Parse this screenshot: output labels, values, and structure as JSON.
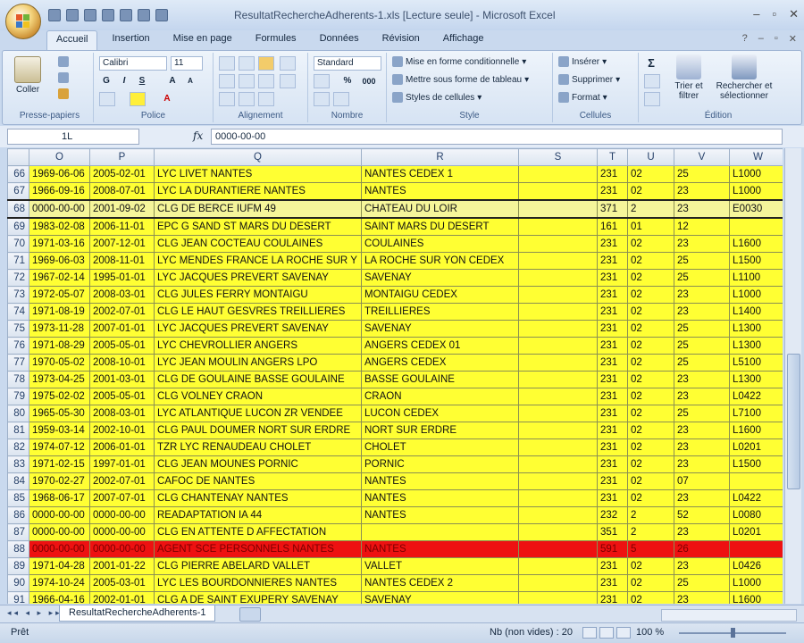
{
  "window": {
    "title": "ResultatRechercheAdherents-1.xls  [Lecture seule] - Microsoft Excel",
    "controls": [
      "–",
      "▫",
      "✕"
    ]
  },
  "ribbon_tabs": [
    "Accueil",
    "Insertion",
    "Mise en page",
    "Formules",
    "Données",
    "Révision",
    "Affichage"
  ],
  "ribbon": {
    "clipboard": {
      "label": "Presse-papiers",
      "paste": "Coller"
    },
    "font": {
      "label": "Police",
      "name": "Calibri",
      "size": "11",
      "bold": "G",
      "italic": "I",
      "underline": "S"
    },
    "alignment": {
      "label": "Alignement"
    },
    "number": {
      "label": "Nombre",
      "format": "Standard",
      "percent": "%",
      "thousands": "000"
    },
    "style": {
      "label": "Style",
      "conditional": "Mise en forme conditionnelle",
      "table": "Mettre sous forme de tableau",
      "cell_styles": "Styles de cellules"
    },
    "cells": {
      "label": "Cellules",
      "insert": "Insérer",
      "delete": "Supprimer",
      "format": "Format"
    },
    "editing": {
      "label": "Édition",
      "sort": "Trier et filtrer",
      "find": "Rechercher et sélectionner",
      "sigma": "Σ"
    }
  },
  "formula_bar": {
    "name_box": "1L",
    "fx": "fx",
    "content": "0000-00-00"
  },
  "columns": [
    "O",
    "P",
    "Q",
    "R",
    "S",
    "T",
    "U",
    "V",
    "W"
  ],
  "rows": [
    {
      "n": "66",
      "cells": [
        "1969-06-06",
        "2005-02-01",
        "LYC LIVET NANTES",
        "NANTES CEDEX 1",
        "",
        "231",
        "02",
        "25",
        "L1000"
      ]
    },
    {
      "n": "67",
      "cells": [
        "1966-09-16",
        "2008-07-01",
        "LYC LA DURANTIERE NANTES",
        "NANTES",
        "",
        "231",
        "02",
        "23",
        "L1000"
      ]
    },
    {
      "n": "68",
      "cells": [
        "0000-00-00",
        "2001-09-02",
        "CLG DE BERCE IUFM 49",
        "CHATEAU DU LOIR",
        "",
        "371",
        "2",
        "23",
        "E0030"
      ],
      "selected": true
    },
    {
      "n": "69",
      "cells": [
        "1983-02-08",
        "2006-11-01",
        "EPC G SAND ST MARS DU DESERT",
        "SAINT MARS DU DESERT",
        "",
        "161",
        "01",
        "12",
        ""
      ]
    },
    {
      "n": "70",
      "cells": [
        "1971-03-16",
        "2007-12-01",
        "CLG JEAN COCTEAU COULAINES",
        "COULAINES",
        "",
        "231",
        "02",
        "23",
        "L1600"
      ]
    },
    {
      "n": "71",
      "cells": [
        "1969-06-03",
        "2008-11-01",
        "LYC MENDES FRANCE LA ROCHE SUR Y",
        "LA ROCHE SUR YON CEDEX",
        "",
        "231",
        "02",
        "25",
        "L1500"
      ]
    },
    {
      "n": "72",
      "cells": [
        "1967-02-14",
        "1995-01-01",
        "LYC JACQUES PREVERT SAVENAY",
        "SAVENAY",
        "",
        "231",
        "02",
        "25",
        "L1100"
      ]
    },
    {
      "n": "73",
      "cells": [
        "1972-05-07",
        "2008-03-01",
        "CLG JULES FERRY MONTAIGU",
        "MONTAIGU CEDEX",
        "",
        "231",
        "02",
        "23",
        "L1000"
      ]
    },
    {
      "n": "74",
      "cells": [
        "1971-08-19",
        "2002-07-01",
        "CLG LE HAUT GESVRES TREILLIERES",
        "TREILLIERES",
        "",
        "231",
        "02",
        "23",
        "L1400"
      ]
    },
    {
      "n": "75",
      "cells": [
        "1973-11-28",
        "2007-01-01",
        "LYC JACQUES PREVERT SAVENAY",
        "SAVENAY",
        "",
        "231",
        "02",
        "25",
        "L1300"
      ]
    },
    {
      "n": "76",
      "cells": [
        "1971-08-29",
        "2005-05-01",
        "LYC CHEVROLLIER ANGERS",
        "ANGERS CEDEX 01",
        "",
        "231",
        "02",
        "25",
        "L1300"
      ]
    },
    {
      "n": "77",
      "cells": [
        "1970-05-02",
        "2008-10-01",
        "LYC JEAN MOULIN ANGERS LPO",
        "ANGERS CEDEX",
        "",
        "231",
        "02",
        "25",
        "L5100"
      ]
    },
    {
      "n": "78",
      "cells": [
        "1973-04-25",
        "2001-03-01",
        "CLG DE GOULAINE BASSE GOULAINE",
        "BASSE GOULAINE",
        "",
        "231",
        "02",
        "23",
        "L1300"
      ]
    },
    {
      "n": "79",
      "cells": [
        "1975-02-02",
        "2005-05-01",
        "CLG VOLNEY CRAON",
        "CRAON",
        "",
        "231",
        "02",
        "23",
        "L0422"
      ]
    },
    {
      "n": "80",
      "cells": [
        "1965-05-30",
        "2008-03-01",
        "LYC ATLANTIQUE LUCON ZR VENDEE",
        "LUCON CEDEX",
        "",
        "231",
        "02",
        "25",
        "L7100"
      ]
    },
    {
      "n": "81",
      "cells": [
        "1959-03-14",
        "2002-10-01",
        "CLG PAUL DOUMER NORT SUR ERDRE",
        "NORT SUR ERDRE",
        "",
        "231",
        "02",
        "23",
        "L1600"
      ]
    },
    {
      "n": "82",
      "cells": [
        "1974-07-12",
        "2006-01-01",
        "TZR LYC RENAUDEAU CHOLET",
        "CHOLET",
        "",
        "231",
        "02",
        "23",
        "L0201"
      ]
    },
    {
      "n": "83",
      "cells": [
        "1971-02-15",
        "1997-01-01",
        "CLG JEAN MOUNES PORNIC",
        "PORNIC",
        "",
        "231",
        "02",
        "23",
        "L1500"
      ]
    },
    {
      "n": "84",
      "cells": [
        "1970-02-27",
        "2002-07-01",
        "CAFOC DE NANTES",
        "NANTES",
        "",
        "231",
        "02",
        "07",
        ""
      ]
    },
    {
      "n": "85",
      "cells": [
        "1968-06-17",
        "2007-07-01",
        "CLG CHANTENAY NANTES",
        "NANTES",
        "",
        "231",
        "02",
        "23",
        "L0422"
      ]
    },
    {
      "n": "86",
      "cells": [
        "0000-00-00",
        "0000-00-00",
        "READAPTATION IA 44",
        "NANTES",
        "",
        "232",
        "2",
        "52",
        "L0080"
      ]
    },
    {
      "n": "87",
      "cells": [
        "0000-00-00",
        "0000-00-00",
        "CLG EN ATTENTE D AFFECTATION",
        "",
        "",
        "351",
        "2",
        "23",
        "L0201"
      ]
    },
    {
      "n": "88",
      "cells": [
        "0000-00-00",
        "0000-00-00",
        "AGENT SCE PERSONNELS NANTES",
        "NANTES",
        "",
        "591",
        "5",
        "26",
        ""
      ],
      "highlight": true
    },
    {
      "n": "89",
      "cells": [
        "1971-04-28",
        "2001-01-22",
        "CLG PIERRE ABELARD VALLET",
        "VALLET",
        "",
        "231",
        "02",
        "23",
        "L0426"
      ]
    },
    {
      "n": "90",
      "cells": [
        "1974-10-24",
        "2005-03-01",
        "LYC LES BOURDONNIERES NANTES",
        "NANTES CEDEX 2",
        "",
        "231",
        "02",
        "25",
        "L1000"
      ]
    },
    {
      "n": "91",
      "cells": [
        "1966-04-16",
        "2002-01-01",
        "CLG A DE SAINT EXUPERY SAVENAY",
        "SAVENAY",
        "",
        "231",
        "02",
        "23",
        "L1600"
      ]
    }
  ],
  "sheet_tab": "ResultatRechercheAdherents-1",
  "status": {
    "ready": "Prêt",
    "count": "Nb (non vides) : 20",
    "zoom": "100 %"
  },
  "colors": {
    "cell_yellow": "#ffff33",
    "row_red": "#ee1111",
    "ribbon_blue": "#d6e3f3"
  }
}
